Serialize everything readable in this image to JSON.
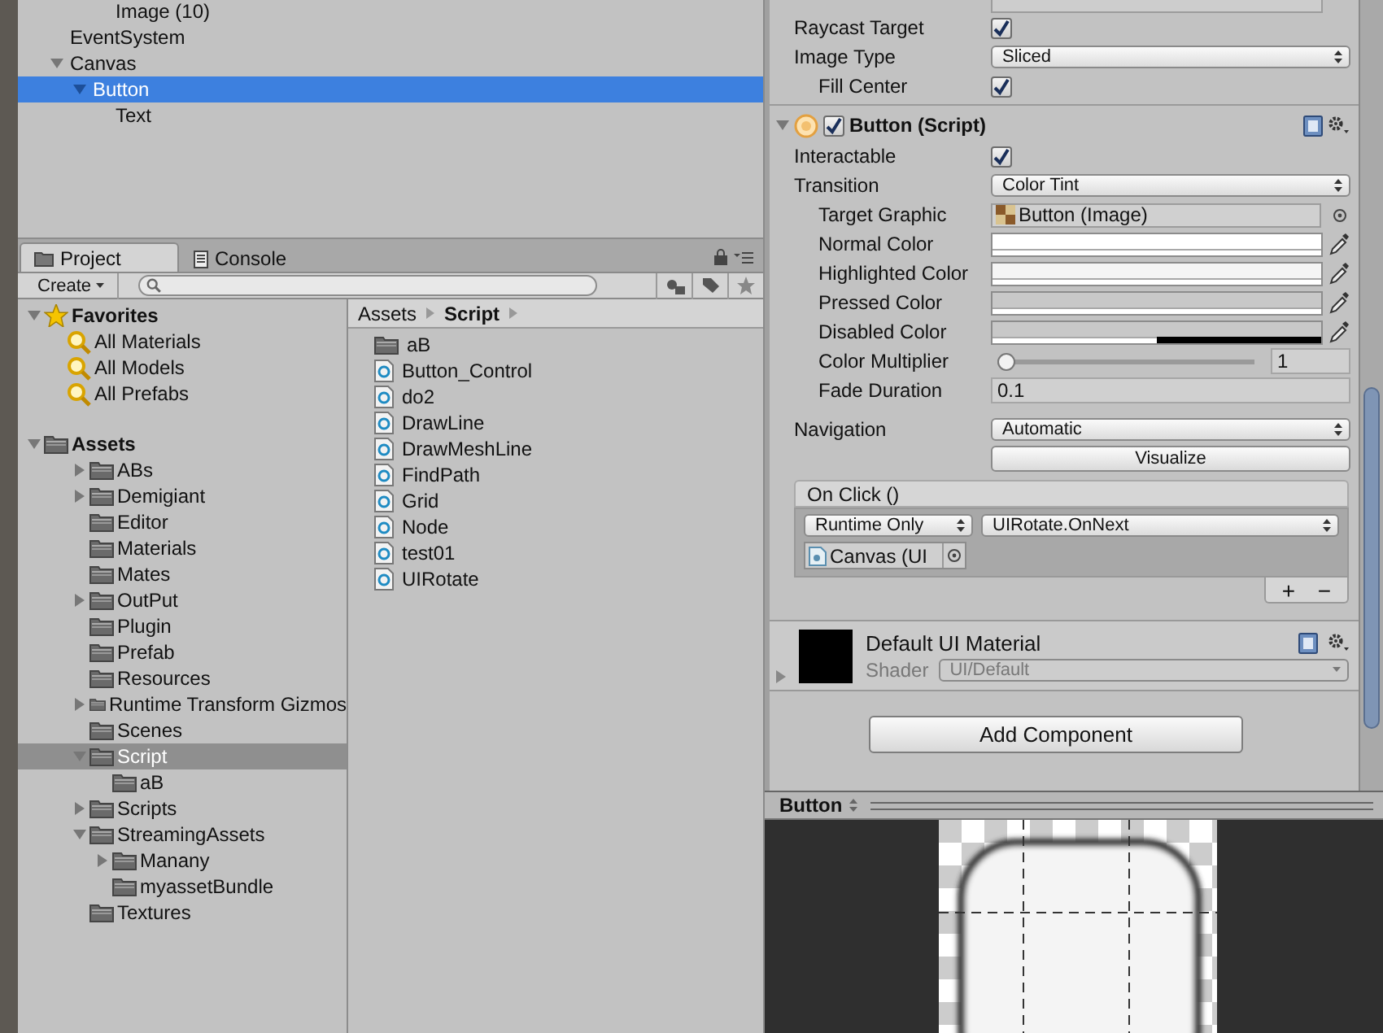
{
  "hierarchy": {
    "clipped_row": "Image (10)",
    "items": [
      {
        "label": "EventSystem",
        "selected": false
      },
      {
        "label": "Canvas",
        "selected": false,
        "expanded": true,
        "children": [
          {
            "label": "Button",
            "selected": true,
            "expanded": true,
            "children": [
              {
                "label": "Text",
                "selected": false
              }
            ]
          }
        ]
      }
    ]
  },
  "project": {
    "tabs": [
      {
        "label": "Project",
        "selected": true,
        "kind": "folder"
      },
      {
        "label": "Console",
        "selected": false,
        "kind": "console"
      }
    ],
    "create": "Create",
    "favorites": {
      "label": "Favorites",
      "expanded": true,
      "items": [
        {
          "label": "All Materials",
          "selected": false
        },
        {
          "label": "All Models",
          "selected": false
        },
        {
          "label": "All Prefabs",
          "selected": false
        }
      ]
    },
    "assets": {
      "label": "Assets",
      "expanded": true,
      "selected": false,
      "children": [
        {
          "label": "ABs",
          "selected": false,
          "expanded": false
        },
        {
          "label": "Demigiant",
          "selected": false,
          "expanded": false
        },
        {
          "label": "Editor",
          "selected": false
        },
        {
          "label": "Materials",
          "selected": false
        },
        {
          "label": "Mates",
          "selected": false
        },
        {
          "label": "OutPut",
          "selected": false,
          "expanded": false
        },
        {
          "label": "Plugin",
          "selected": false
        },
        {
          "label": "Prefab",
          "selected": false
        },
        {
          "label": "Resources",
          "selected": false
        },
        {
          "label": "Runtime Transform Gizmos",
          "selected": false,
          "expanded": false
        },
        {
          "label": "Scenes",
          "selected": false
        },
        {
          "label": "Script",
          "selected": true,
          "expanded": true,
          "children": [
            {
              "label": "aB",
              "selected": false
            }
          ]
        },
        {
          "label": "Scripts",
          "selected": false,
          "expanded": false
        },
        {
          "label": "StreamingAssets",
          "selected": false,
          "expanded": true,
          "children": [
            {
              "label": "Manany",
              "selected": false,
              "expanded": false
            },
            {
              "label": "myassetBundle",
              "selected": false
            }
          ]
        },
        {
          "label": "Textures",
          "selected": false
        }
      ]
    },
    "breadcrumb": [
      "Assets",
      "Script"
    ],
    "files": [
      {
        "name": "aB",
        "kind": "folder"
      },
      {
        "name": "Button_Control",
        "kind": "script"
      },
      {
        "name": "do2",
        "kind": "script"
      },
      {
        "name": "DrawLine",
        "kind": "script"
      },
      {
        "name": "DrawMeshLine",
        "kind": "script"
      },
      {
        "name": "FindPath",
        "kind": "script"
      },
      {
        "name": "Grid",
        "kind": "script"
      },
      {
        "name": "Node",
        "kind": "script"
      },
      {
        "name": "test01",
        "kind": "script"
      },
      {
        "name": "UIRotate",
        "kind": "script"
      }
    ]
  },
  "inspector": {
    "image_rows": [
      {
        "label": "Raycast Target",
        "kind": "checkbox",
        "checked": true
      },
      {
        "label": "Image Type",
        "kind": "dropdown",
        "value": "Sliced",
        "children": [
          {
            "label": "Fill Center",
            "kind": "checkbox",
            "checked": true
          }
        ]
      }
    ],
    "component": {
      "title": "Button (Script)",
      "enabled": true,
      "expanded": true,
      "rows": [
        {
          "label": "Interactable",
          "kind": "checkbox",
          "checked": true
        },
        {
          "label": "Transition",
          "kind": "dropdown",
          "value": "Color Tint",
          "children": [
            {
              "label": "Target Graphic",
              "kind": "object",
              "value": "Button (Image)"
            },
            {
              "label": "Normal Color",
              "kind": "color",
              "color": "#ffffff",
              "level": 1
            },
            {
              "label": "Highlighted Color",
              "kind": "color",
              "color": "#f5f5f5",
              "level": 1
            },
            {
              "label": "Pressed Color",
              "kind": "color",
              "color": "#c8c8c8",
              "level": 1
            },
            {
              "label": "Disabled Color",
              "kind": "color",
              "color": "#c8c8c8",
              "level": 0.5
            },
            {
              "label": "Color Multiplier",
              "kind": "slider",
              "level": 0,
              "value": "1"
            },
            {
              "label": "Fade Duration",
              "kind": "number",
              "value": "0.1"
            }
          ]
        }
      ]
    },
    "navigation": {
      "label": "Navigation",
      "value": "Automatic",
      "button": "Visualize"
    },
    "on_click": {
      "title": "On Click ()",
      "entries": [
        {
          "mode": "Runtime Only",
          "function": "UIRotate.OnNext",
          "target": "Canvas (UI"
        }
      ],
      "buttons": [
        "+",
        "−"
      ]
    },
    "material": {
      "name": "Default UI Material",
      "shader_label": "Shader",
      "shader": "UI/Default"
    },
    "add_component": "Add Component"
  },
  "preview": {
    "title": "Button"
  }
}
